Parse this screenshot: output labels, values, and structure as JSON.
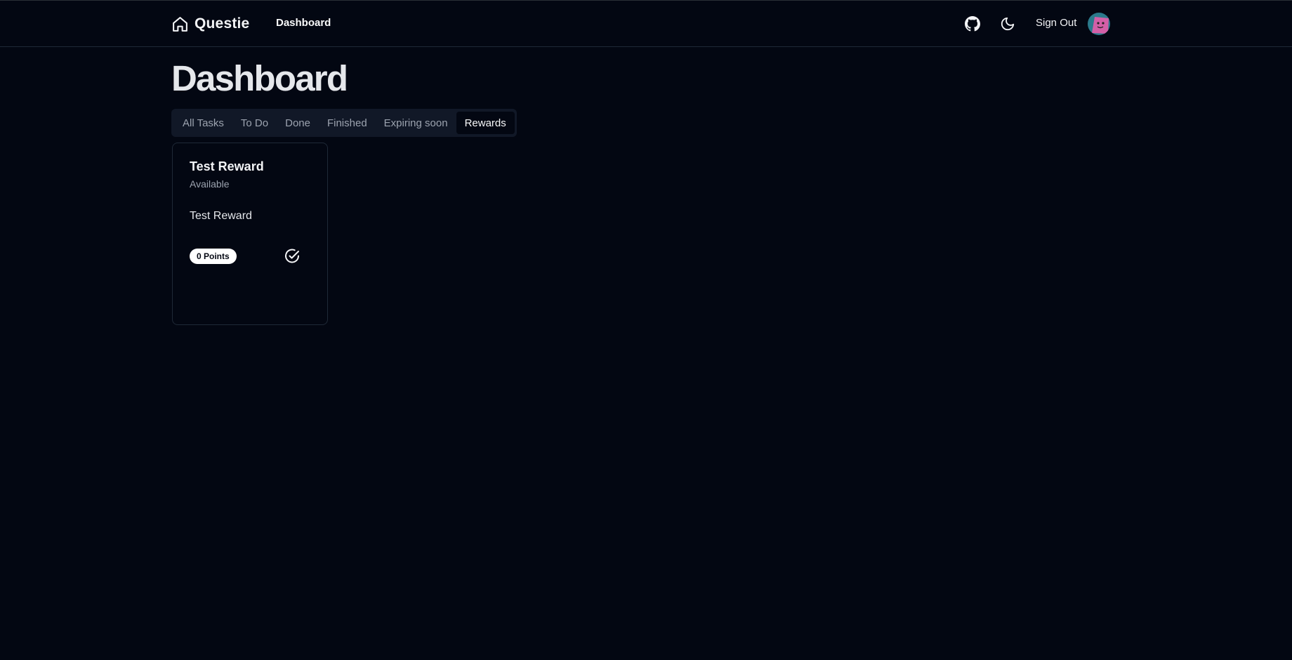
{
  "header": {
    "brand": "Questie",
    "nav_link": "Dashboard",
    "sign_out": "Sign Out",
    "icons": [
      "home-icon",
      "github-icon",
      "moon-icon",
      "avatar"
    ]
  },
  "page": {
    "title": "Dashboard"
  },
  "tabs": [
    {
      "label": "All Tasks",
      "active": false
    },
    {
      "label": "To Do",
      "active": false
    },
    {
      "label": "Done",
      "active": false
    },
    {
      "label": "Finished",
      "active": false
    },
    {
      "label": "Expiring soon",
      "active": false
    },
    {
      "label": "Rewards",
      "active": true
    }
  ],
  "rewards": [
    {
      "title": "Test Reward",
      "status": "Available",
      "description": "Test Reward",
      "points_label": "0 Points",
      "action_icon": "check-circle-icon"
    }
  ],
  "colors": {
    "background": "#030712",
    "tab_bar": "#111827",
    "border": "#1f2937",
    "muted_text": "#9ca3af",
    "badge_bg": "#ffffff"
  }
}
